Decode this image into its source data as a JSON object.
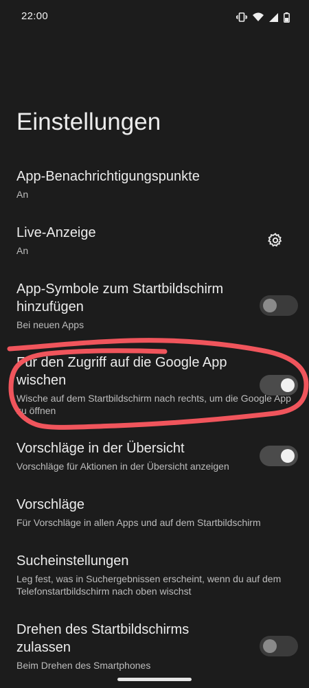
{
  "status_bar": {
    "time": "22:00",
    "icons": [
      "vibrate-icon",
      "wifi-icon",
      "signal-icon",
      "battery-icon"
    ]
  },
  "page": {
    "title": "Einstellungen"
  },
  "settings": [
    {
      "title": "App-Benachrichtigungspunkte",
      "subtitle": "An",
      "control": "none"
    },
    {
      "title": "Live-Anzeige",
      "subtitle": "An",
      "control": "gear-icon"
    },
    {
      "title": "App-Symbole zum Startbildschirm hinzufügen",
      "subtitle": "Bei neuen Apps",
      "control": "toggle",
      "enabled": false
    },
    {
      "title": "Für den Zugriff auf die Google App wischen",
      "subtitle": "Wische auf dem Startbildschirm nach rechts, um die Google App zu öffnen",
      "control": "toggle",
      "enabled": true
    },
    {
      "title": "Vorschläge in der Übersicht",
      "subtitle": "Vorschläge für Aktionen in der Übersicht anzeigen",
      "control": "toggle",
      "enabled": true
    },
    {
      "title": "Vorschläge",
      "subtitle": "Für Vorschläge in allen Apps und auf dem Startbildschirm",
      "control": "none"
    },
    {
      "title": "Sucheinstellungen",
      "subtitle": "Leg fest, was in Suchergebnissen erscheint, wenn du auf dem Telefonstartbildschirm nach oben wischst",
      "control": "none"
    },
    {
      "title": "Drehen des Startbildschirms zulassen",
      "subtitle": "Beim Drehen des Smartphones",
      "control": "toggle",
      "enabled": false
    }
  ],
  "colors": {
    "background": "#1c1c1c",
    "annotation": "#f0555c"
  }
}
